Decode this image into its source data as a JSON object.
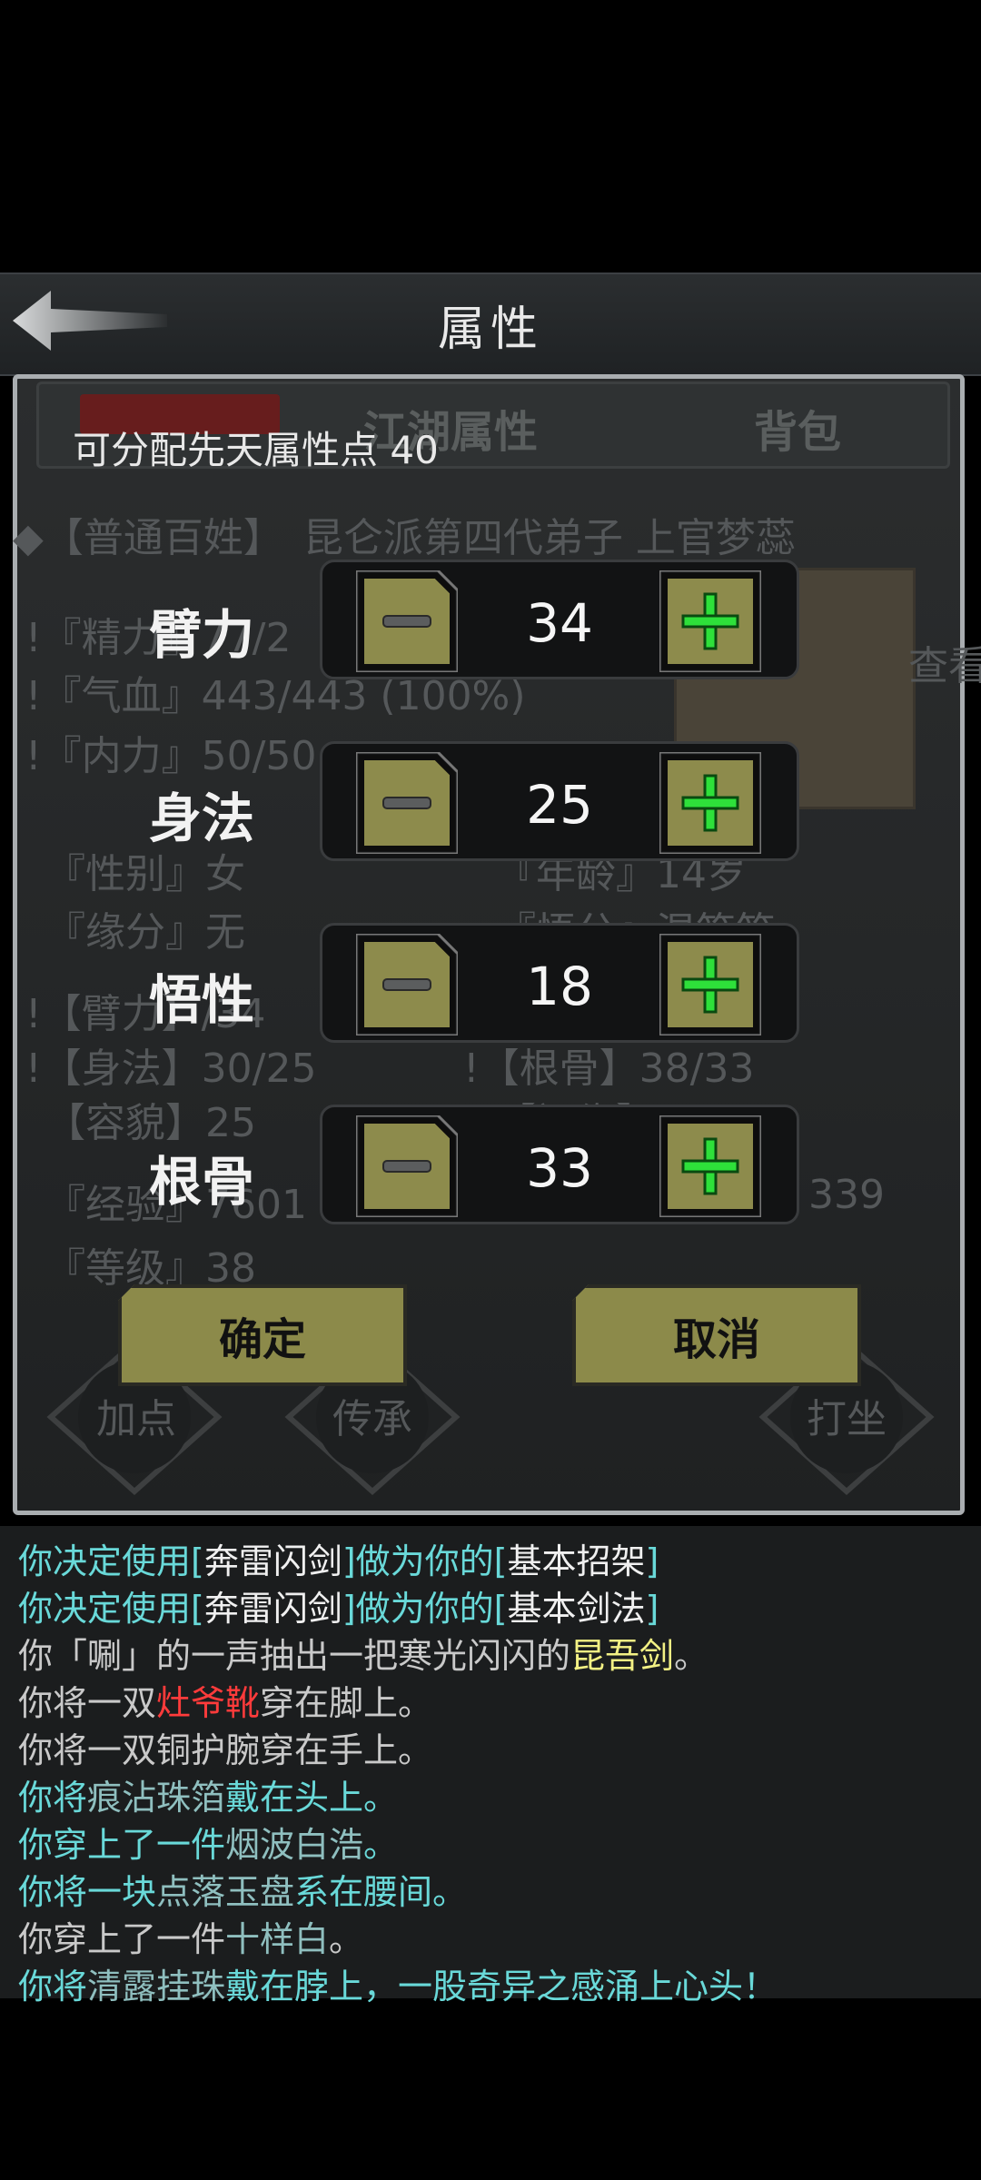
{
  "header": {
    "title": "属性"
  },
  "background": {
    "tabs": [
      "江湖属性",
      "背包"
    ],
    "identity": "◆【普通百姓】　昆仑派第四代弟子 上官梦蕊",
    "stats": [
      "!『精力』77/2",
      "!『气血』443/443 (100%)",
      "!『内力』50/50",
      "『性别』女",
      "『缘分』无",
      "!【臂力】/34",
      "!【身法】30/25",
      "【容貌】25",
      "『经验』7601",
      "『等级』38"
    ],
    "right_stats": [
      "『年龄』14岁",
      "『悟分』混筋笆",
      "!【根骨】38/33",
      "【福缘】25",
      "339"
    ],
    "side_button": "查看",
    "bottom_buttons": [
      "加点",
      "传承",
      "打坐"
    ]
  },
  "dialog": {
    "points_label": "可分配先天属性点 40",
    "attributes": [
      {
        "label": "臂力",
        "value": "34"
      },
      {
        "label": "身法",
        "value": "25"
      },
      {
        "label": "悟性",
        "value": "18"
      },
      {
        "label": "根骨",
        "value": "33"
      }
    ],
    "confirm": "确定",
    "cancel": "取消"
  },
  "log": [
    [
      {
        "t": "你决定使用[",
        "c": "cyan"
      },
      {
        "t": "奔雷闪剑",
        "c": "white"
      },
      {
        "t": "]做为你的[",
        "c": "cyan"
      },
      {
        "t": "基本招架",
        "c": "white"
      },
      {
        "t": "]",
        "c": "cyan"
      }
    ],
    [
      {
        "t": "你决定使用[",
        "c": "cyan"
      },
      {
        "t": "奔雷闪剑",
        "c": "white"
      },
      {
        "t": "]做为你的[",
        "c": "cyan"
      },
      {
        "t": "基本剑法",
        "c": "white"
      },
      {
        "t": "]",
        "c": "cyan"
      }
    ],
    [
      {
        "t": "你「唰」的一声抽出一把寒光闪闪的",
        "c": "gray"
      },
      {
        "t": "昆吾剑",
        "c": "yellow"
      },
      {
        "t": "。",
        "c": "gray"
      }
    ],
    [
      {
        "t": "你将一双",
        "c": "gray"
      },
      {
        "t": "灶爷靴",
        "c": "red"
      },
      {
        "t": "穿在脚上。",
        "c": "gray"
      }
    ],
    [
      {
        "t": "你将一双铜护腕穿在手上。",
        "c": "gray"
      }
    ],
    [
      {
        "t": "你将",
        "c": "cyan"
      },
      {
        "t": "痕沾珠箔",
        "c": "teal"
      },
      {
        "t": "戴在头上。",
        "c": "cyan"
      }
    ],
    [
      {
        "t": "你穿上了一件",
        "c": "cyan"
      },
      {
        "t": "烟波白浩",
        "c": "teal"
      },
      {
        "t": "。",
        "c": "cyan"
      }
    ],
    [
      {
        "t": "你将一块",
        "c": "cyan"
      },
      {
        "t": "点落玉盘",
        "c": "teal"
      },
      {
        "t": "系在腰间。",
        "c": "cyan"
      }
    ],
    [
      {
        "t": "你穿上了一件",
        "c": "gray"
      },
      {
        "t": "十样白",
        "c": "teal"
      },
      {
        "t": "。",
        "c": "gray"
      }
    ],
    [
      {
        "t": "你将",
        "c": "cyan"
      },
      {
        "t": "清露挂珠",
        "c": "teal"
      },
      {
        "t": "戴在脖上，一股奇异之感涌上心头！",
        "c": "cyan"
      }
    ]
  ]
}
